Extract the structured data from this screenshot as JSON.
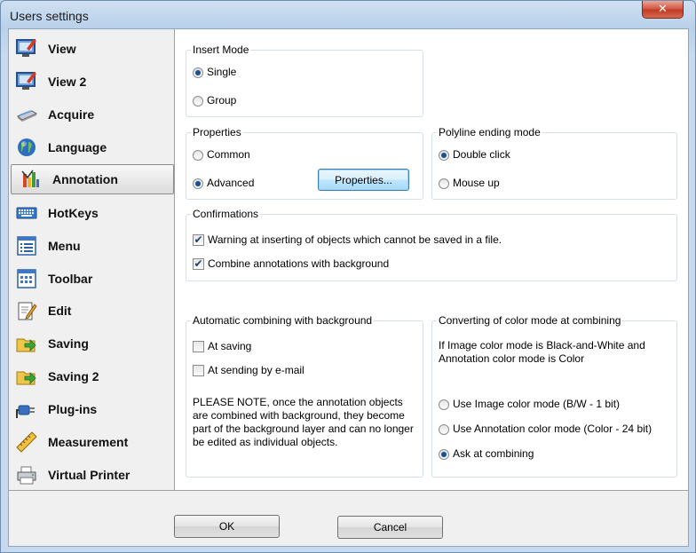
{
  "window": {
    "title": "Users settings",
    "close_glyph": "✕"
  },
  "sidebar": {
    "items": [
      {
        "label": "View",
        "icon": "view-icon"
      },
      {
        "label": "View 2",
        "icon": "view2-icon"
      },
      {
        "label": "Acquire",
        "icon": "scanner-icon"
      },
      {
        "label": "Language",
        "icon": "globe-icon"
      },
      {
        "label": "Annotation",
        "icon": "annotation-icon",
        "selected": true
      },
      {
        "label": "HotKeys",
        "icon": "keyboard-icon"
      },
      {
        "label": "Menu",
        "icon": "menu-icon"
      },
      {
        "label": "Toolbar",
        "icon": "toolbar-icon"
      },
      {
        "label": "Edit",
        "icon": "edit-icon"
      },
      {
        "label": "Saving",
        "icon": "saving-icon"
      },
      {
        "label": "Saving 2",
        "icon": "saving2-icon"
      },
      {
        "label": "Plug-ins",
        "icon": "plugins-icon"
      },
      {
        "label": "Measurement",
        "icon": "ruler-icon"
      },
      {
        "label": "Virtual Printer",
        "icon": "printer-icon"
      }
    ]
  },
  "insert_mode": {
    "title": "Insert Mode",
    "options": [
      {
        "label": "Single",
        "checked": true
      },
      {
        "label": "Group",
        "checked": false
      }
    ]
  },
  "properties": {
    "title": "Properties",
    "options": [
      {
        "label": "Common",
        "checked": false
      },
      {
        "label": "Advanced",
        "checked": true
      }
    ],
    "button_label": "Properties..."
  },
  "polyline": {
    "title": "Polyline ending mode",
    "options": [
      {
        "label": "Double click",
        "checked": true
      },
      {
        "label": "Mouse up",
        "checked": false
      }
    ]
  },
  "confirmations": {
    "title": "Confirmations",
    "items": [
      {
        "label": "Warning at inserting of objects which cannot be saved in a file.",
        "checked": true
      },
      {
        "label": "Combine annotations with background",
        "checked": true
      }
    ]
  },
  "auto_combine": {
    "title": "Automatic combining with background",
    "items": [
      {
        "label": "At saving",
        "checked": false
      },
      {
        "label": "At sending by e-mail",
        "checked": false
      }
    ],
    "note": "PLEASE NOTE, once the annotation objects are combined with background, they become part of the background layer and can no longer be edited as individual objects."
  },
  "color_mode": {
    "title": "Converting of color mode at combining",
    "description": "If Image color mode is Black-and-White and Annotation color mode is Color",
    "options": [
      {
        "label": "Use Image color mode (B/W - 1 bit)",
        "checked": false
      },
      {
        "label": "Use Annotation color mode (Color - 24 bit)",
        "checked": false
      },
      {
        "label": "Ask at combining",
        "checked": true
      }
    ]
  },
  "footer": {
    "ok_label": "OK",
    "cancel_label": "Cancel"
  },
  "check_glyph": "✔"
}
